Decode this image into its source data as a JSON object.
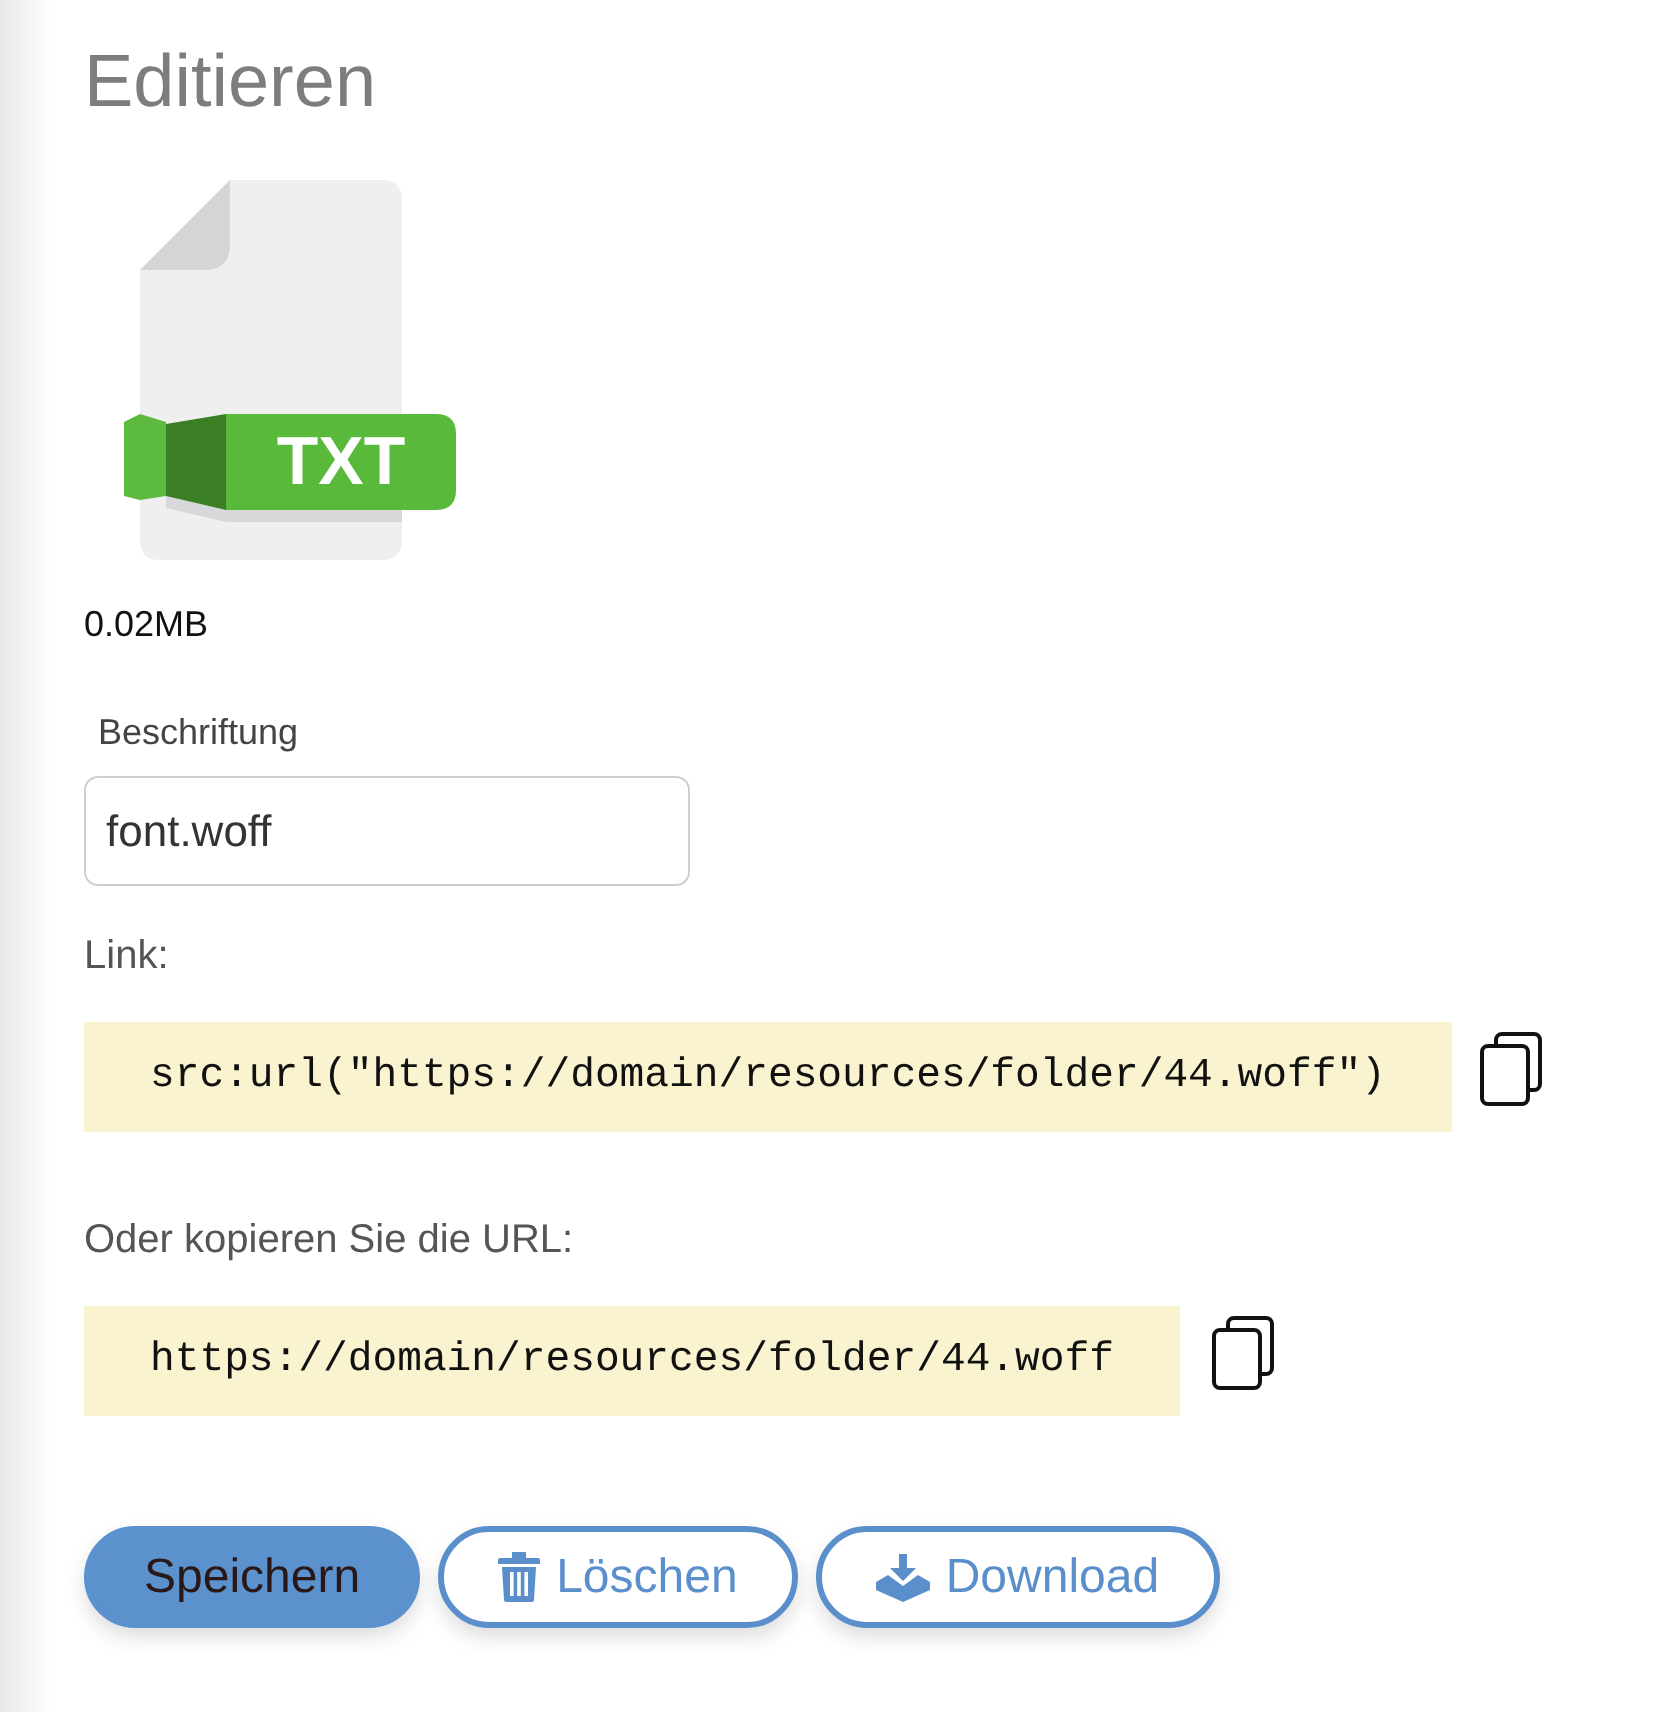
{
  "heading": "Editieren",
  "file": {
    "badge": "TXT",
    "size": "0.02MB"
  },
  "caption_field": {
    "label": "Beschriftung",
    "value": "font.woff"
  },
  "link": {
    "label": "Link:",
    "code": "src:url(\"https://domain/resources/folder/44.woff\")"
  },
  "url": {
    "label": "Oder kopieren Sie die URL:",
    "code": "https://domain/resources/folder/44.woff"
  },
  "buttons": [
    {
      "label": "Speichern",
      "kind": "primary"
    },
    {
      "label": "Löschen",
      "kind": "delete"
    },
    {
      "label": "Download",
      "kind": "download"
    }
  ]
}
